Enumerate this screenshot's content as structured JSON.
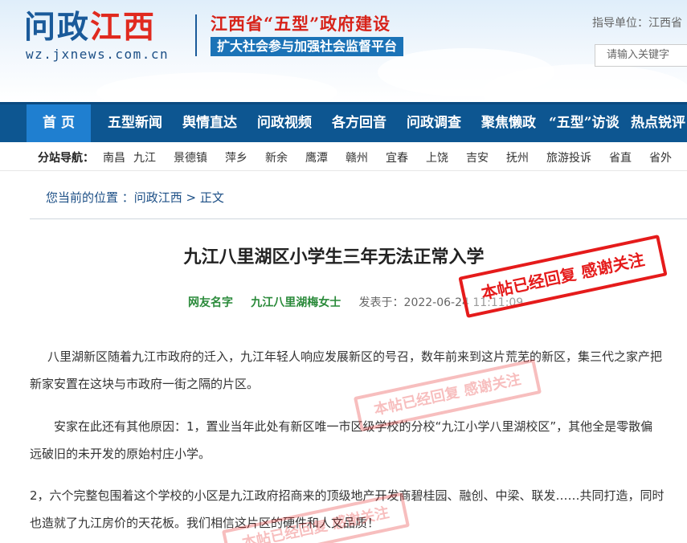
{
  "header": {
    "logo_part1": "问政",
    "logo_part2": "江西",
    "logo_url": "wz.jxnews.com.cn",
    "slogan_title": "江西省“五型”政府建设",
    "slogan_sub": "扩大社会参与加强社会监督平台",
    "guide_label": "指导单位：江西省",
    "search_placeholder": "请输入关键字"
  },
  "nav": {
    "items": [
      "首 页",
      "五型新闻",
      "舆情直达",
      "问政视频",
      "各方回音",
      "问政调查",
      "聚焦懒政",
      "“五型”访谈",
      "热点锐评"
    ]
  },
  "subnav": {
    "label": "分站导航：",
    "items": [
      "南昌",
      "九江",
      "景德镇",
      "萍乡",
      "新余",
      "鹰潭",
      "赣州",
      "宜春",
      "上饶",
      "吉安",
      "抚州",
      "旅游投诉",
      "省直",
      "省外"
    ]
  },
  "breadcrumb": "您当前的位置 ：问政江西 > 正文",
  "article": {
    "title": "九江八里湖区小学生三年无法正常入学",
    "author_label": "网友名字",
    "author_name": "九江八里湖梅女士",
    "date": "发表于：2022-06-24 11:11:09",
    "stamp_text": "本帖已经回复 感谢关注",
    "paragraphs": [
      "八里湖新区随着九江市政府的迁入，九江年轻人响应发展新区的号召，数年前来到这片荒芜的新区，集三代之家产把新家安置在这块与市政府一街之隔的片区。",
      "安家在此还有其他原因：1，置业当年此处有新区唯一市区级学校的分校“九江小学八里湖校区”，其他全是零散偏远破旧的未开发的原始村庄小学。",
      "2，六个完整包围着这个学校的小区是九江政府招商来的顶级地产开发商碧桂园、融创、中梁、联发……共同打造，同时也造就了九江房价的天花板。我们相信这片区的硬件和人文品质！"
    ]
  },
  "colors": {
    "nav_bg": "#0d5691",
    "nav_active": "#1f7fd0",
    "stamp_red": "#e51b1b",
    "author_green": "#2a8a3a"
  }
}
